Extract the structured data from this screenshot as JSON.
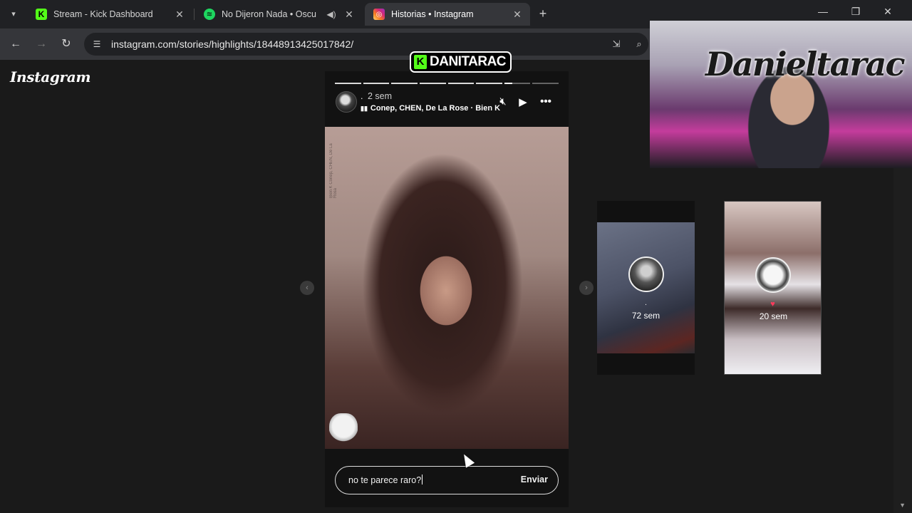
{
  "browser": {
    "tabs": [
      {
        "title": "Stream - Kick Dashboard",
        "favicon": "kick-icon",
        "color": "#53fc18"
      },
      {
        "title": "No Dijeron Nada • Oscu",
        "favicon": "spotify-icon",
        "color": "#1ed760",
        "audio": "speaker-icon"
      },
      {
        "title": "Historias • Instagram",
        "favicon": "instagram-icon",
        "color": "#e1306c",
        "active": true
      }
    ],
    "url": "instagram.com/stories/highlights/18448913425017842/"
  },
  "page": {
    "logo": "Instagram",
    "story": {
      "username": ".",
      "time": "2 sem",
      "music": "Conep, CHEN, De La Rose · Bien K",
      "side_text": "Bien K Conep, CHEN, De La Rosa",
      "progress": {
        "segments": 8,
        "current": 7,
        "fraction": 0.3
      },
      "reply": {
        "value": "no te parece raro?",
        "send_label": "Enviar"
      }
    },
    "highlights": [
      {
        "dot": ".",
        "time": "72 sem"
      },
      {
        "heart": "♥",
        "time": "20 sem"
      }
    ]
  },
  "overlay": {
    "channel": "DANITARAC",
    "webcam_text": "Danieltarac"
  }
}
